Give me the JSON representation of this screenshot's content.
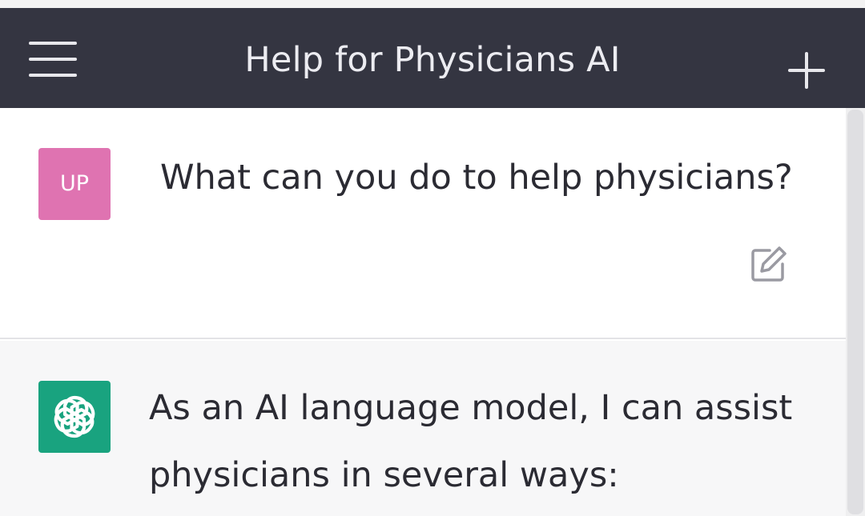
{
  "header": {
    "title": "Help for Physicians AI",
    "menu_icon": "hamburger-menu-icon",
    "new_chat_icon": "plus-icon"
  },
  "messages": {
    "user": {
      "avatar_initials": "UP",
      "avatar_color": "#df73b1",
      "text": "What can you do to help physicians?",
      "edit_icon": "edit-icon"
    },
    "assistant": {
      "avatar_icon": "openai-logo-icon",
      "avatar_color": "#19a37f",
      "text": "As an AI language model, I can assist physicians in several ways:"
    }
  },
  "colors": {
    "header_bg": "#343541",
    "assistant_bg": "#f7f7f8"
  }
}
